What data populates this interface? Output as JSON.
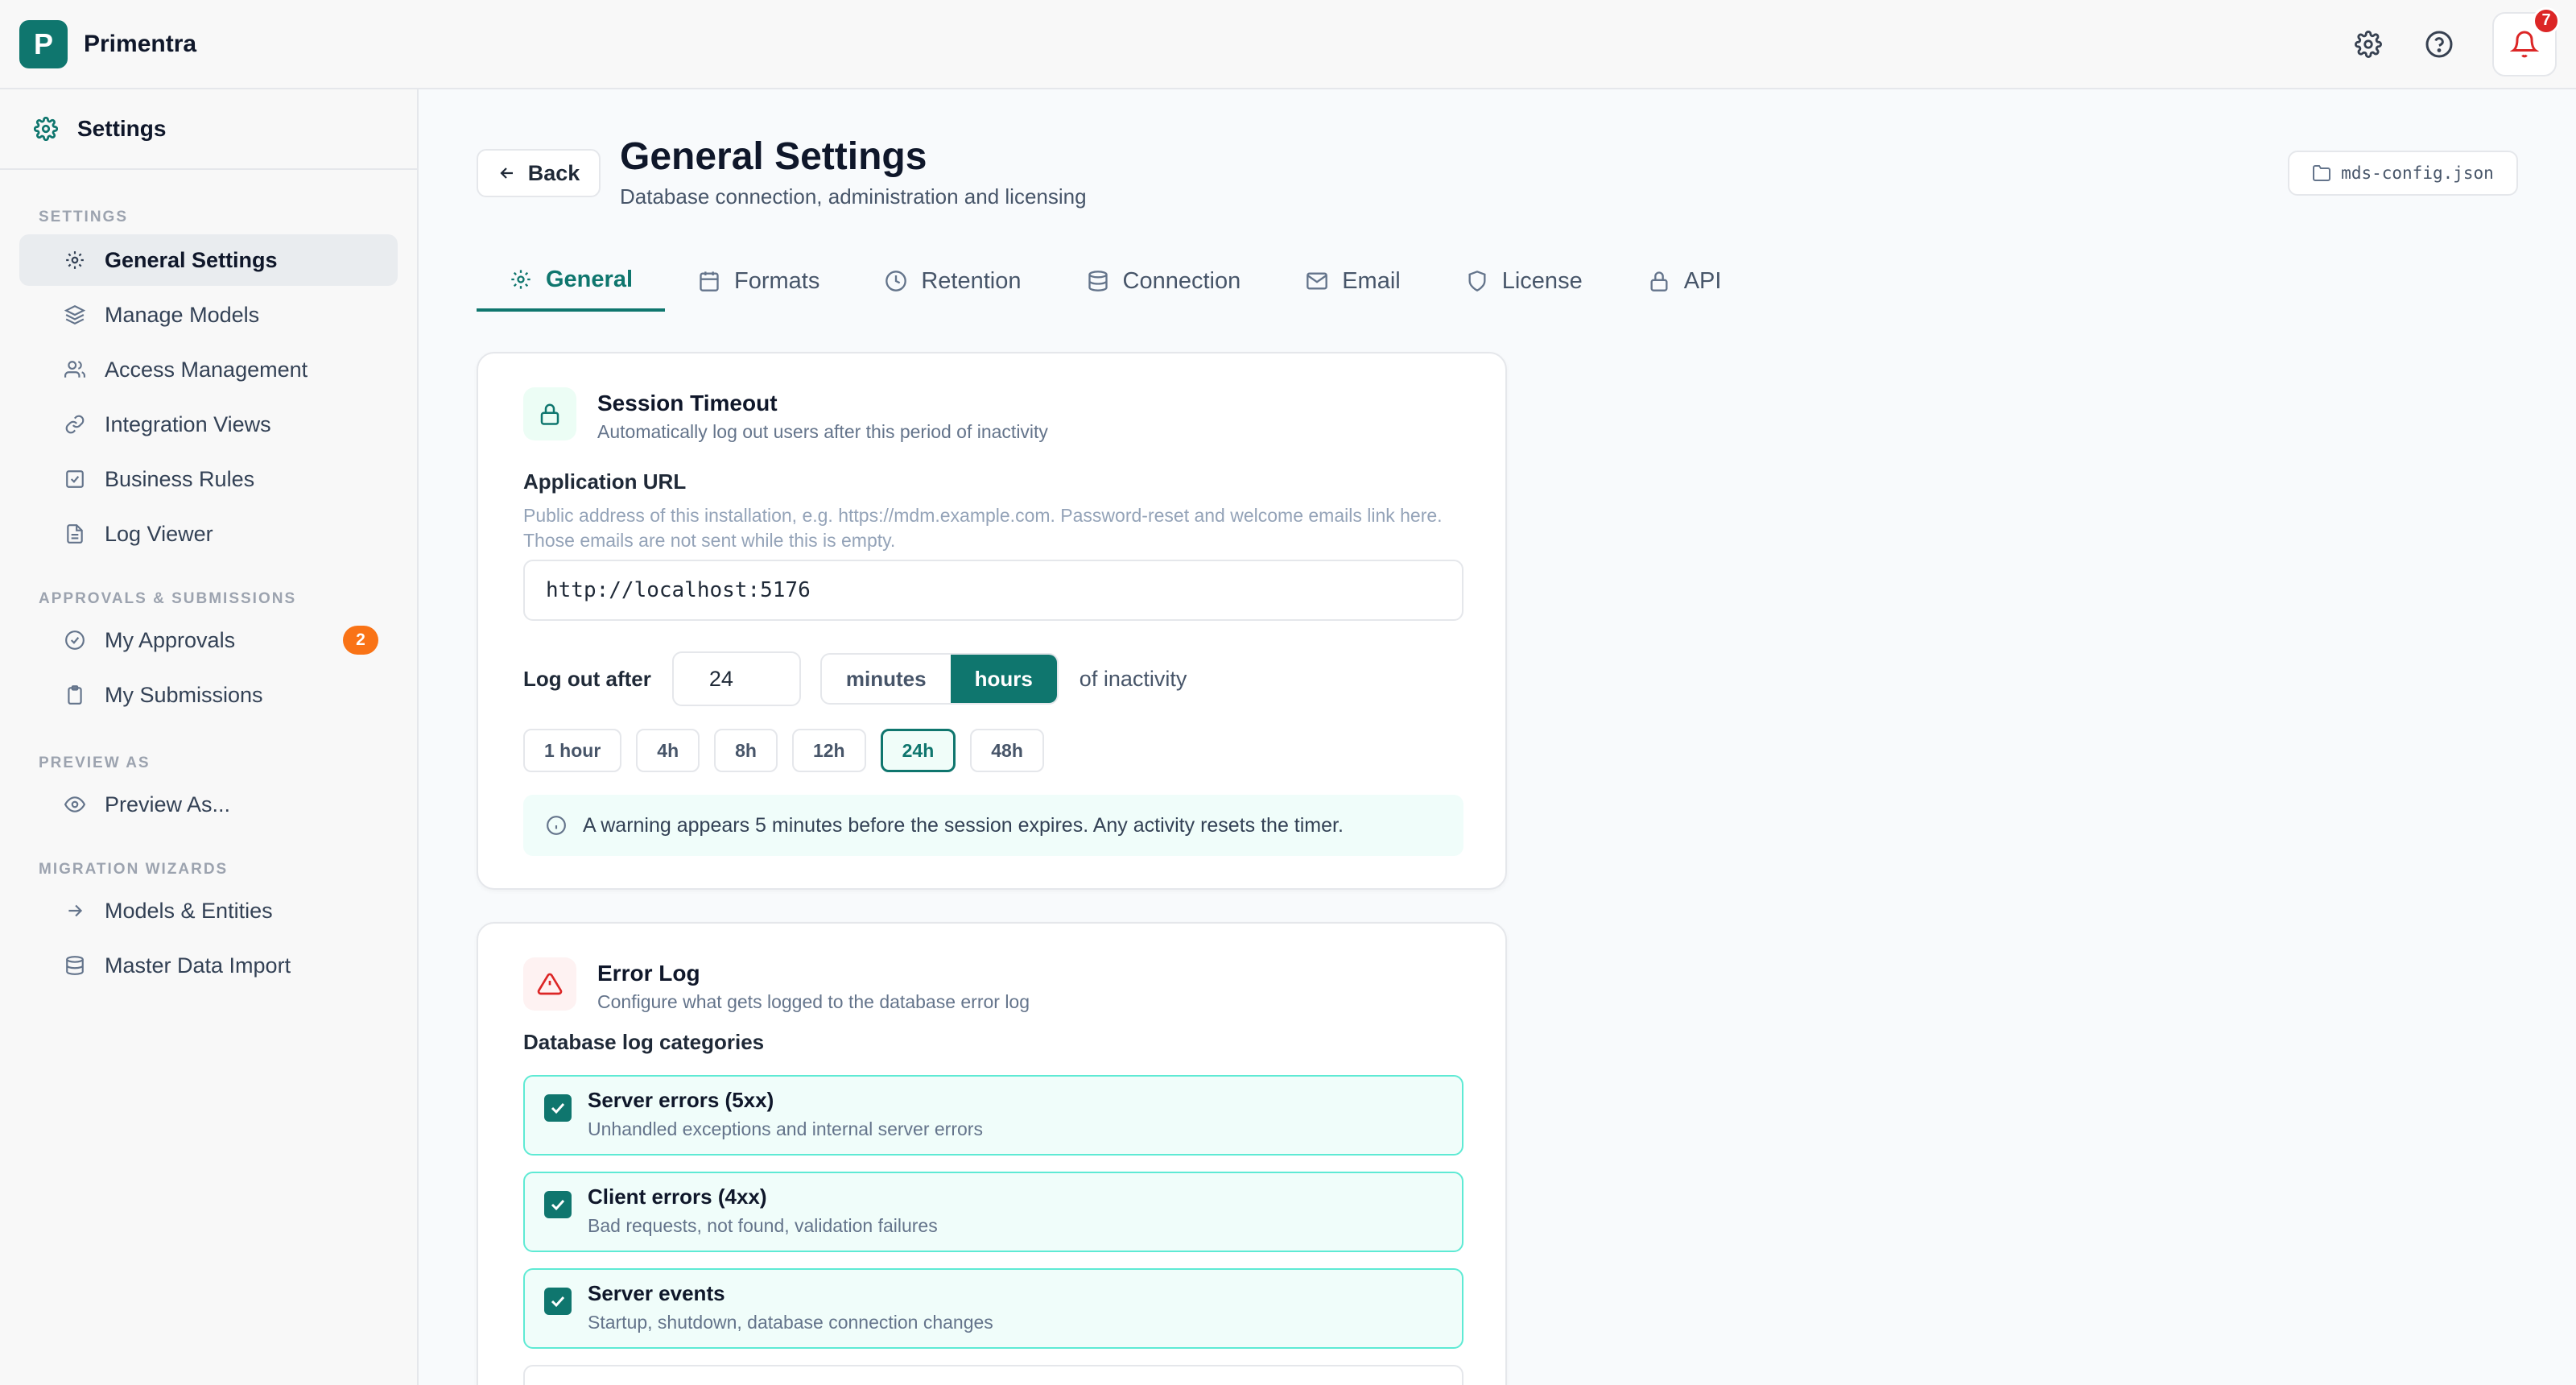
{
  "app": {
    "name": "Primentra",
    "logo_letter": "P",
    "notification_count": "7"
  },
  "sidebar": {
    "title": "Settings",
    "sections": [
      {
        "label": "Settings",
        "items": [
          {
            "label": "General Settings",
            "icon": "gear-icon",
            "active": true
          },
          {
            "label": "Manage Models",
            "icon": "layers-icon"
          },
          {
            "label": "Access Management",
            "icon": "users-icon"
          },
          {
            "label": "Integration Views",
            "icon": "link-icon"
          },
          {
            "label": "Business Rules",
            "icon": "checkbox-icon"
          },
          {
            "label": "Log Viewer",
            "icon": "document-icon"
          }
        ]
      },
      {
        "label": "Approvals & Submissions",
        "items": [
          {
            "label": "My Approvals",
            "icon": "check-circle-icon",
            "badge": "2"
          },
          {
            "label": "My Submissions",
            "icon": "clipboard-icon"
          }
        ]
      },
      {
        "label": "Preview As",
        "items": [
          {
            "label": "Preview As...",
            "icon": "eye-icon"
          }
        ]
      },
      {
        "label": "Migration Wizards",
        "items": [
          {
            "label": "Models & Entities",
            "icon": "arrow-right-icon"
          },
          {
            "label": "Master Data Import",
            "icon": "database-icon"
          }
        ]
      }
    ]
  },
  "header": {
    "back_label": "Back",
    "title": "General Settings",
    "subtitle": "Database connection, administration and licensing",
    "config_file": "mds-config.json"
  },
  "tabs": [
    {
      "label": "General",
      "icon": "gear-icon",
      "active": true
    },
    {
      "label": "Formats",
      "icon": "calendar-icon"
    },
    {
      "label": "Retention",
      "icon": "clock-icon"
    },
    {
      "label": "Connection",
      "icon": "database-icon"
    },
    {
      "label": "Email",
      "icon": "mail-icon"
    },
    {
      "label": "License",
      "icon": "shield-icon"
    },
    {
      "label": "API",
      "icon": "lock-icon"
    }
  ],
  "session": {
    "title": "Session Timeout",
    "description": "Automatically log out users after this period of inactivity",
    "url_label": "Application URL",
    "url_help": "Public address of this installation, e.g. https://mdm.example.com. Password-reset and welcome emails link here. Those emails are not sent while this is empty.",
    "url_value": "http://localhost:5176",
    "logout_label": "Log out after",
    "logout_value": "24",
    "unit_minutes": "minutes",
    "unit_hours": "hours",
    "selected_unit": "hours",
    "suffix": "of inactivity",
    "presets": [
      "1 hour",
      "4h",
      "8h",
      "12h",
      "24h",
      "48h"
    ],
    "selected_preset": "24h",
    "info": "A warning appears 5 minutes before the session expires. Any activity resets the timer."
  },
  "error_log": {
    "title": "Error Log",
    "description": "Configure what gets logged to the database error log",
    "categories_label": "Database log categories",
    "categories": [
      {
        "title": "Server errors (5xx)",
        "desc": "Unhandled exceptions and internal server errors",
        "checked": true
      },
      {
        "title": "Client errors (4xx)",
        "desc": "Bad requests, not found, validation failures",
        "checked": true
      },
      {
        "title": "Server events",
        "desc": "Startup, shutdown, database connection changes",
        "checked": true
      }
    ]
  },
  "colors": {
    "accent": "#0f766e",
    "badge_orange": "#f97316",
    "alert_red": "#dc2626"
  }
}
